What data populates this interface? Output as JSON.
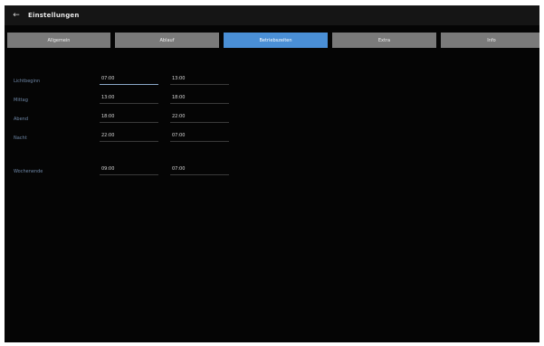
{
  "header": {
    "back_icon": "arrow-left-icon",
    "title": "Einstellungen"
  },
  "tabs": [
    {
      "label": "Allgemein",
      "active": false
    },
    {
      "label": "Ablauf",
      "active": false
    },
    {
      "label": "Betriebszeiten",
      "active": true
    },
    {
      "label": "Extra",
      "active": false
    },
    {
      "label": "Info",
      "active": false
    }
  ],
  "schedule": [
    {
      "day": "Lichtbeginn",
      "from": "07:00",
      "to": "13:00",
      "focused": true
    },
    {
      "day": "Mittag",
      "from": "13:00",
      "to": "18:00",
      "focused": false
    },
    {
      "day": "Abend",
      "from": "18:00",
      "to": "22:00",
      "focused": false
    },
    {
      "day": "Nacht",
      "from": "22:00",
      "to": "07:00",
      "focused": false
    },
    {
      "day": "Wochenende",
      "from": "09:00",
      "to": "07:00",
      "focused": false
    }
  ],
  "colors": {
    "background": "#050505",
    "topbar": "#151515",
    "tab": "#7a7a7a",
    "tab_active": "#4a8fd6",
    "label": "#6f88a8"
  }
}
